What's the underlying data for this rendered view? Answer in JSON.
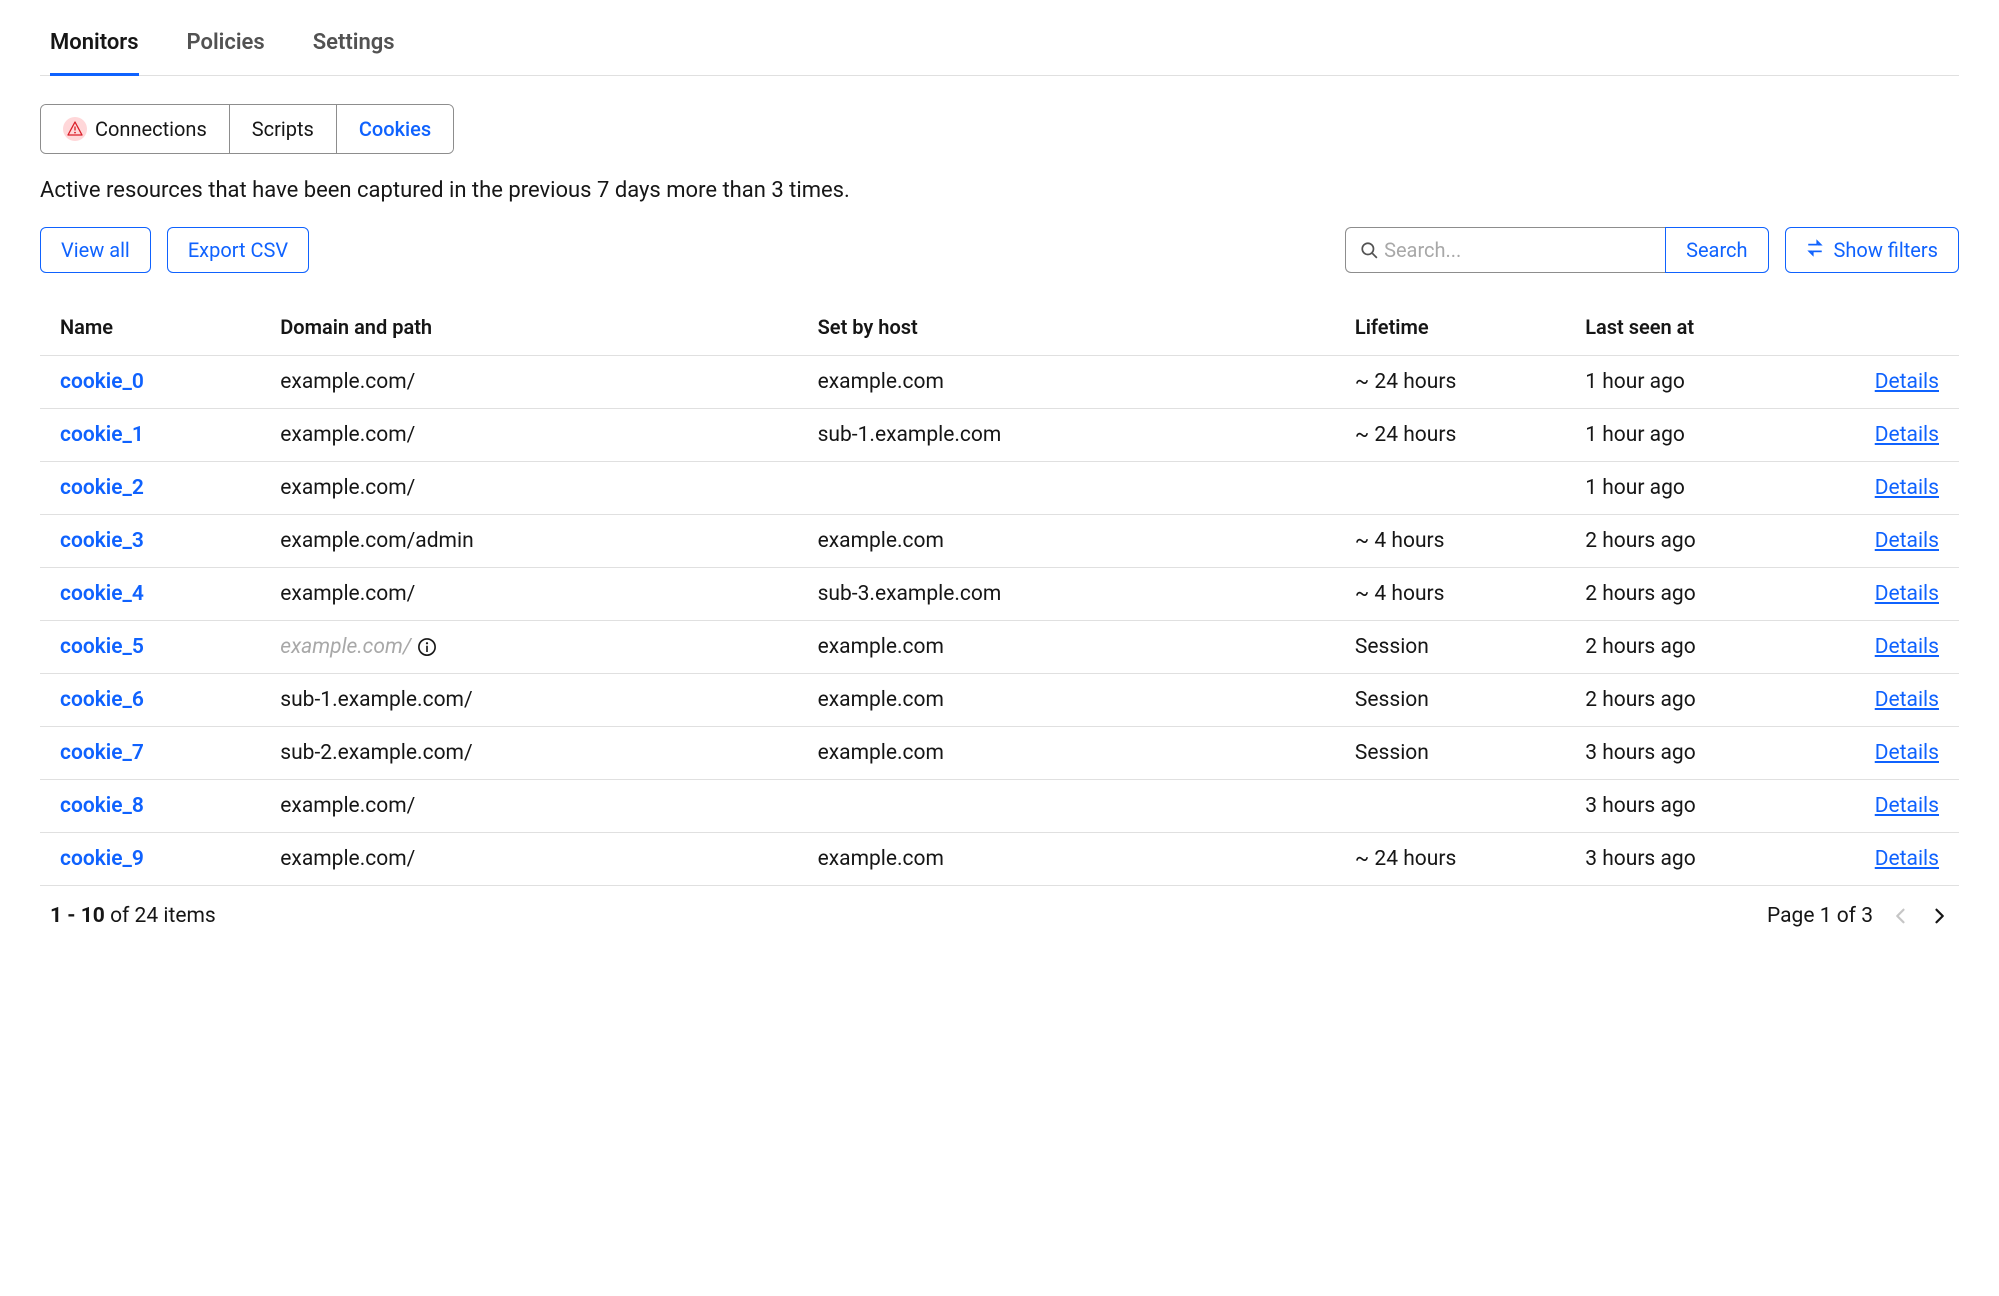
{
  "top_tabs": {
    "monitors": "Monitors",
    "policies": "Policies",
    "settings": "Settings"
  },
  "sub_tabs": {
    "connections": "Connections",
    "scripts": "Scripts",
    "cookies": "Cookies"
  },
  "description": "Active resources that have been captured in the previous 7 days more than 3 times.",
  "toolbar": {
    "view_all": "View all",
    "export_csv": "Export CSV",
    "search_placeholder": "Search...",
    "search_button": "Search",
    "show_filters": "Show filters"
  },
  "table": {
    "headers": {
      "name": "Name",
      "domain_path": "Domain and path",
      "set_by_host": "Set by host",
      "lifetime": "Lifetime",
      "last_seen": "Last seen at",
      "details": ""
    },
    "details_label": "Details",
    "rows": [
      {
        "name": "cookie_0",
        "domain": "example.com/",
        "domain_muted": false,
        "host": "example.com",
        "lifetime": "~ 24 hours",
        "last_seen": "1 hour ago"
      },
      {
        "name": "cookie_1",
        "domain": "example.com/",
        "domain_muted": false,
        "host": "sub-1.example.com",
        "lifetime": "~ 24 hours",
        "last_seen": "1 hour ago"
      },
      {
        "name": "cookie_2",
        "domain": "example.com/",
        "domain_muted": false,
        "host": "",
        "lifetime": "",
        "last_seen": "1 hour ago"
      },
      {
        "name": "cookie_3",
        "domain": "example.com/admin",
        "domain_muted": false,
        "host": "example.com",
        "lifetime": "~ 4 hours",
        "last_seen": "2 hours ago"
      },
      {
        "name": "cookie_4",
        "domain": "example.com/",
        "domain_muted": false,
        "host": "sub-3.example.com",
        "lifetime": "~ 4 hours",
        "last_seen": "2 hours ago"
      },
      {
        "name": "cookie_5",
        "domain": "example.com/",
        "domain_muted": true,
        "host": "example.com",
        "lifetime": "Session",
        "last_seen": "2 hours ago"
      },
      {
        "name": "cookie_6",
        "domain": "sub-1.example.com/",
        "domain_muted": false,
        "host": "example.com",
        "lifetime": "Session",
        "last_seen": "2 hours ago"
      },
      {
        "name": "cookie_7",
        "domain": "sub-2.example.com/",
        "domain_muted": false,
        "host": "example.com",
        "lifetime": "Session",
        "last_seen": "3 hours ago"
      },
      {
        "name": "cookie_8",
        "domain": "example.com/",
        "domain_muted": false,
        "host": "",
        "lifetime": "",
        "last_seen": "3 hours ago"
      },
      {
        "name": "cookie_9",
        "domain": "example.com/",
        "domain_muted": false,
        "host": "example.com",
        "lifetime": "~ 24 hours",
        "last_seen": "3 hours ago"
      }
    ]
  },
  "pagination": {
    "range": "1 - 10",
    "of_items": " of 24 items",
    "page_label": "Page 1 of 3"
  }
}
